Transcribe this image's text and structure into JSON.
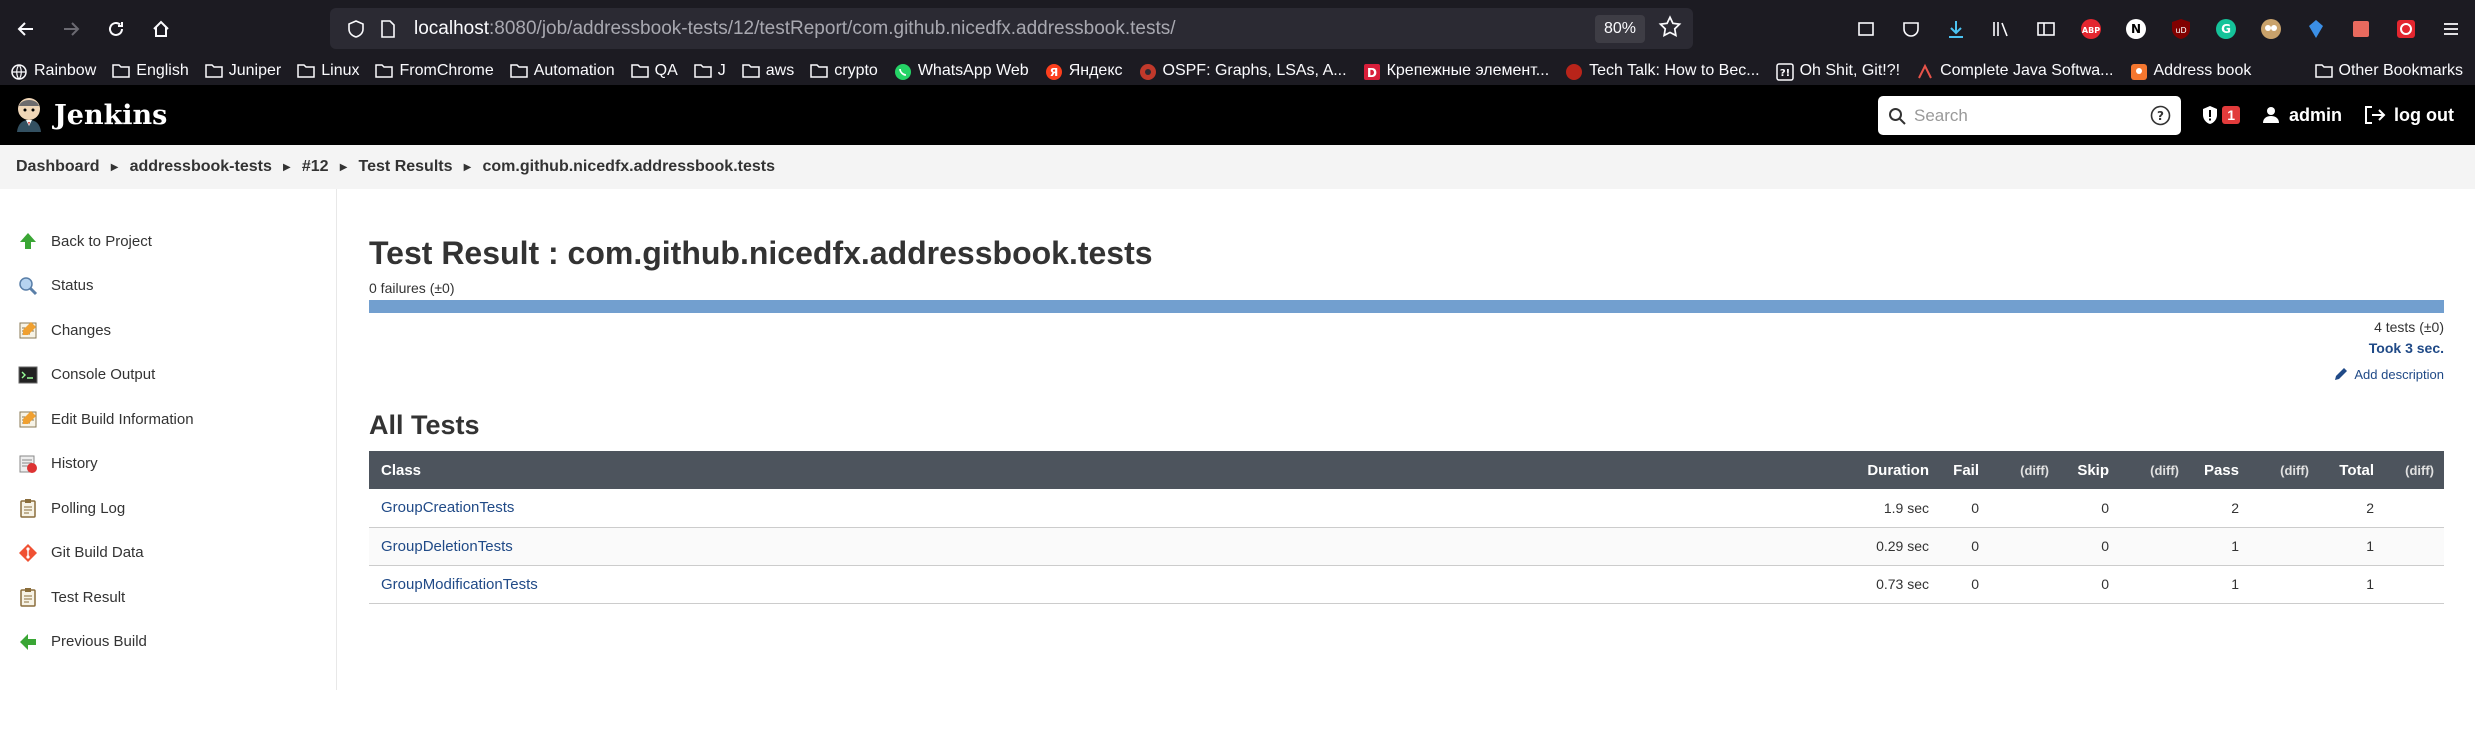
{
  "browser": {
    "url_host": "localhost",
    "url_rest": ":8080/job/addressbook-tests/12/testReport/com.github.nicedfx.addressbook.tests/",
    "zoom": "80%"
  },
  "bookmarks": [
    {
      "label": "Rainbow",
      "icon": "globe-icon"
    },
    {
      "label": "English",
      "icon": "folder-icon"
    },
    {
      "label": "Juniper",
      "icon": "folder-icon"
    },
    {
      "label": "Linux",
      "icon": "folder-icon"
    },
    {
      "label": "FromChrome",
      "icon": "folder-icon"
    },
    {
      "label": "Automation",
      "icon": "folder-icon"
    },
    {
      "label": "QA",
      "icon": "folder-icon"
    },
    {
      "label": "J",
      "icon": "folder-icon"
    },
    {
      "label": "aws",
      "icon": "folder-icon"
    },
    {
      "label": "crypto",
      "icon": "folder-icon"
    },
    {
      "label": "WhatsApp Web",
      "icon": "whatsapp-icon"
    },
    {
      "label": "Яндекс",
      "icon": "yandex-icon"
    },
    {
      "label": "OSPF: Graphs, LSAs, A...",
      "icon": "ospf-icon"
    },
    {
      "label": "Крепежные элемент...",
      "icon": "d-icon"
    },
    {
      "label": "Tech Talk: How to Bec...",
      "icon": "red-circle-icon"
    },
    {
      "label": "Oh Shit, Git!?!",
      "icon": "git-icon"
    },
    {
      "label": "Complete Java Softwa...",
      "icon": "java-icon"
    },
    {
      "label": "Address book",
      "icon": "addressbook-icon"
    }
  ],
  "bookmarks_other": "Other Bookmarks",
  "jenkins": {
    "title": "Jenkins",
    "search_placeholder": "Search",
    "alert_count": "1",
    "user": "admin",
    "logout": "log out"
  },
  "breadcrumbs": [
    "Dashboard",
    "addressbook-tests",
    "#12",
    "Test Results",
    "com.github.nicedfx.addressbook.tests"
  ],
  "sidebar": [
    {
      "label": "Back to Project",
      "icon": "up-arrow-icon"
    },
    {
      "label": "Status",
      "icon": "search-icon"
    },
    {
      "label": "Changes",
      "icon": "notepad-icon"
    },
    {
      "label": "Console Output",
      "icon": "terminal-icon"
    },
    {
      "label": "Edit Build Information",
      "icon": "notepad-icon"
    },
    {
      "label": "History",
      "icon": "history-icon"
    },
    {
      "label": "Polling Log",
      "icon": "clipboard-icon"
    },
    {
      "label": "Git Build Data",
      "icon": "git-icon"
    },
    {
      "label": "Test Result",
      "icon": "clipboard-icon"
    },
    {
      "label": "Previous Build",
      "icon": "left-arrow-icon"
    }
  ],
  "result": {
    "title": "Test Result : com.github.nicedfx.addressbook.tests",
    "failures": "0 failures (±0)",
    "tests": "4 tests (±0)",
    "took": "Took 3 sec.",
    "add_description": "Add description",
    "all_tests_heading": "All Tests",
    "pass_fraction": 1.0
  },
  "table": {
    "headers": {
      "class": "Class",
      "duration": "Duration",
      "fail": "Fail",
      "diff": "(diff)",
      "skip": "Skip",
      "pass": "Pass",
      "total": "Total"
    },
    "rows": [
      {
        "class": "GroupCreationTests",
        "duration": "1.9 sec",
        "fail": "0",
        "skip": "0",
        "pass": "2",
        "total": "2"
      },
      {
        "class": "GroupDeletionTests",
        "duration": "0.29 sec",
        "fail": "0",
        "skip": "0",
        "pass": "1",
        "total": "1"
      },
      {
        "class": "GroupModificationTests",
        "duration": "0.73 sec",
        "fail": "0",
        "skip": "0",
        "pass": "1",
        "total": "1"
      }
    ]
  },
  "colors": {
    "accent": "#204a87",
    "pass_bar": "#729fcf",
    "table_header": "#4d545d"
  }
}
